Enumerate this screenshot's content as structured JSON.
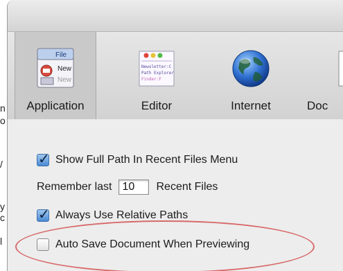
{
  "background": {
    "fragments": [
      "n",
      "o",
      "/",
      "y",
      "c",
      "l"
    ]
  },
  "toolbar": {
    "items": [
      {
        "label": "Application",
        "icon": "application-icon",
        "selected": true
      },
      {
        "label": "Editor",
        "icon": "editor-icon",
        "selected": false
      },
      {
        "label": "Internet",
        "icon": "globe-icon",
        "selected": false
      },
      {
        "label": "Doc",
        "icon": "document-icon",
        "selected": false
      }
    ],
    "app_icon_lines": [
      "File",
      "New",
      "New"
    ],
    "editor_icon_lines": [
      "Newsletter:C",
      "Path Explorer",
      "Finder:F"
    ]
  },
  "settings": {
    "show_full_path": {
      "label": "Show Full Path In Recent Files Menu",
      "checked": true
    },
    "remember_last": {
      "prefix": "Remember last",
      "value": "10",
      "suffix": "Recent Files"
    },
    "relative_paths": {
      "label": "Always Use Relative Paths",
      "checked": true
    },
    "auto_save": {
      "label": "Auto Save Document When Previewing",
      "checked": false
    }
  },
  "colors": {
    "highlight": "#d86a6a",
    "checkbox_checked": "#4b8ad4"
  }
}
